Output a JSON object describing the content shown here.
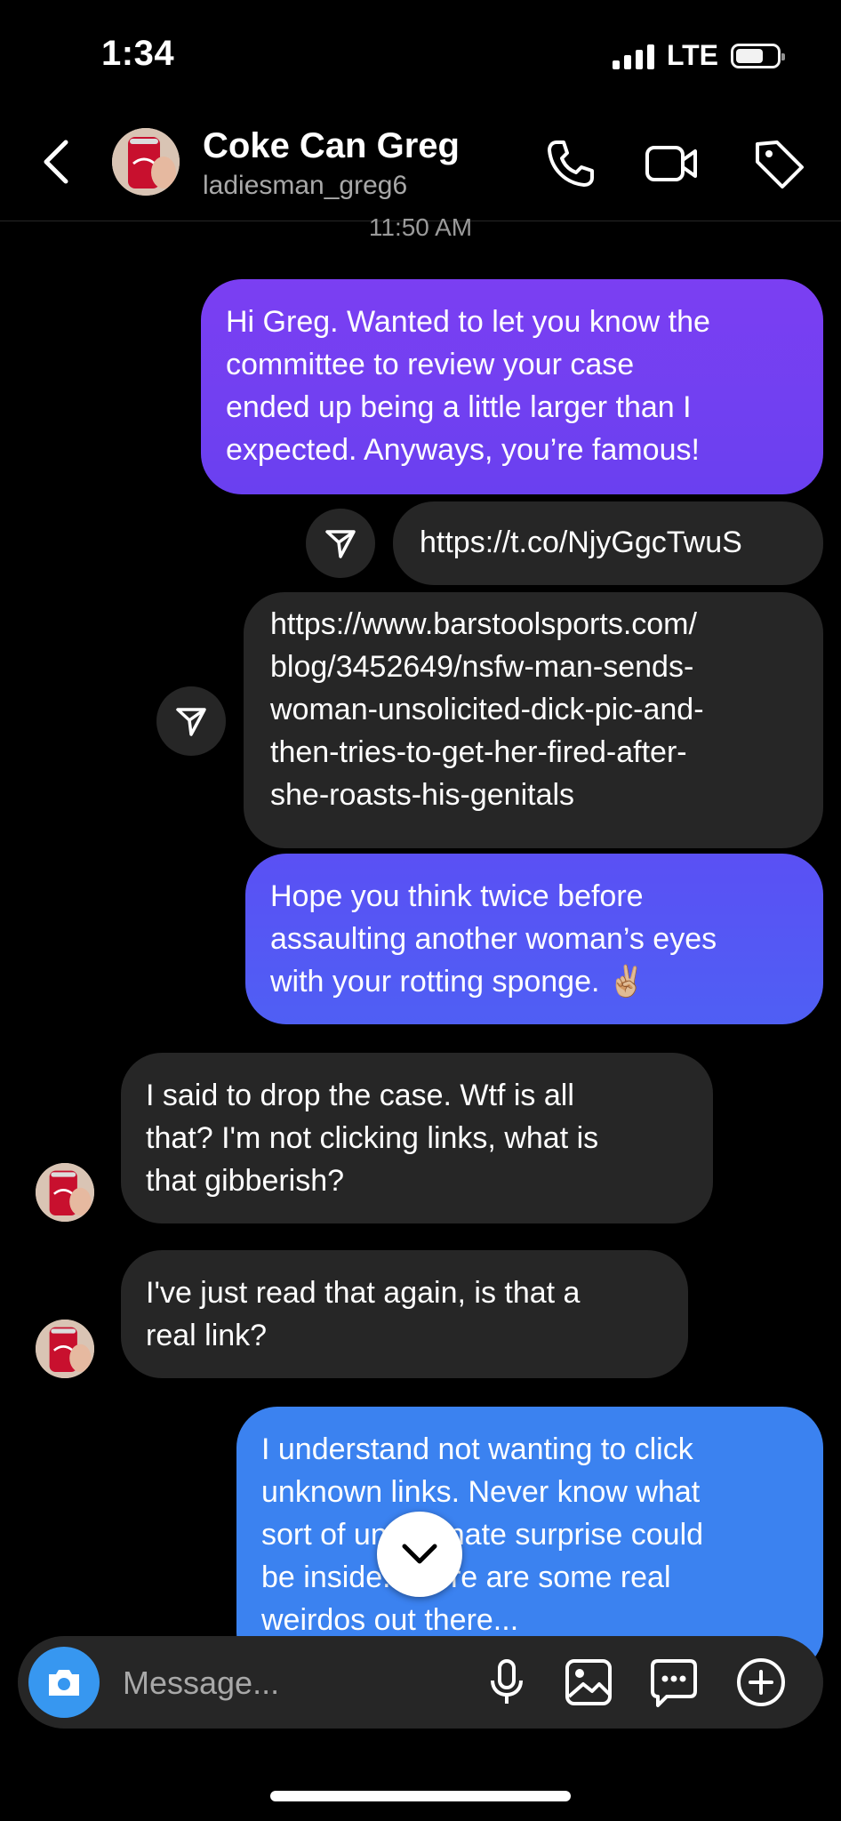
{
  "status_bar": {
    "time": "1:34",
    "network": "LTE"
  },
  "header": {
    "title": "Coke Can Greg",
    "username": "ladiesman_greg6",
    "icons": [
      "back-chevron-icon",
      "phone-icon",
      "video-camera-icon",
      "tag-icon"
    ]
  },
  "thread": {
    "timestamp": "11:50 AM",
    "messages": [
      {
        "from": "me",
        "text": "Hi Greg. Wanted to let you know the\ncommittee to review your case\nended up being a little larger than I\nexpected. Anyways, you’re famous!"
      },
      {
        "from": "me",
        "text": "https://t.co/NjyGgcTwuS"
      },
      {
        "from": "me",
        "text": "https://www.barstoolsports.com/\nblog/3452649/nsfw-man-sends-\nwoman-unsolicited-dick-pic-and-\nthen-tries-to-get-her-fired-after-\nshe-roasts-his-genitals"
      },
      {
        "from": "me",
        "text": "Hope you think twice before\nassaulting another woman’s eyes\nwith your rotting sponge. ✌🏼"
      },
      {
        "from": "them",
        "text": "I said to drop the case. Wtf is all\nthat? I'm not clicking links, what is\nthat gibberish?"
      },
      {
        "from": "them",
        "text": "I've just read that again, is that a\nreal link?"
      },
      {
        "from": "me",
        "text": "I understand not wanting to click\nunknown links. Never know what\nsort of unfortunate surprise could\nbe inside. There are some real\nweirdos out there..."
      }
    ]
  },
  "composer": {
    "placeholder": "Message...",
    "icons": [
      "camera-icon",
      "microphone-icon",
      "gallery-icon",
      "sticker-chat-icon",
      "plus-icon"
    ]
  },
  "colors": {
    "background": "#000000",
    "incoming_bubble": "#262626",
    "outgoing_purple": "#6f3ff2",
    "outgoing_blue": "#3b82f0",
    "camera_button": "#3797f0"
  }
}
